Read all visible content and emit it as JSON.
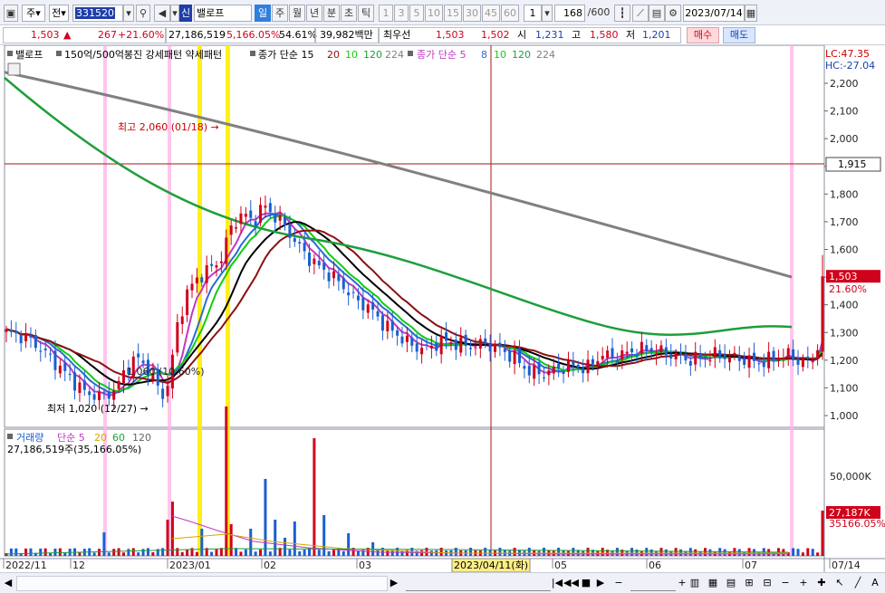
{
  "toolbar": {
    "market": "주",
    "period_type": "전",
    "stock_code": "331520",
    "stock_name": "밸로프",
    "tabs": [
      "일",
      "주",
      "월",
      "년",
      "분",
      "초",
      "틱"
    ],
    "active_tab": "일",
    "intervals": [
      "1",
      "3",
      "5",
      "10",
      "15",
      "30",
      "45",
      "60"
    ],
    "count_select": "1",
    "count_value": "168",
    "count_max": "/600",
    "date": "2023/07/14"
  },
  "quote": {
    "price": "1,503",
    "arrow": "▲",
    "change": "267",
    "change_pct": "+21.60%",
    "volume": "27,186,519",
    "volume_pct": "5,166.05%",
    "turnover_pct": "54.61%",
    "amount": "39,982백만",
    "ask_label": "최우선",
    "ask": "1,503",
    "bid": "1,502",
    "open_label": "시",
    "open": "1,231",
    "high_label": "고",
    "high": "1,580",
    "low_label": "저",
    "low": "1,201",
    "buy_label": "매수",
    "sell_label": "매도"
  },
  "legend": {
    "name": "밸로프",
    "pattern_text": "150억/500억봉진 강세패턴  약세패턴",
    "ma_label": "종가 단순 15",
    "ma_periods": [
      "20",
      "10",
      "120",
      "224"
    ],
    "ma2_label": "종가 단순 5",
    "ma2_periods": [
      "8",
      "10",
      "120",
      "224"
    ],
    "lc": "LC:47.35",
    "hc": "HC:-27.04"
  },
  "price_axis": {
    "ticks": [
      "2,200",
      "2,100",
      "2,000",
      "1,900",
      "1,800",
      "1,700",
      "1,600",
      "1,500",
      "1,400",
      "1,300",
      "1,200",
      "1,100",
      "1,000"
    ],
    "current_label": "1,503",
    "current_pct": "21.60%",
    "crosshair_label": "1,915"
  },
  "annotations": {
    "high": "최고 2,060 (01/18)",
    "low": "최저 1,020 (12/27)",
    "mid": "1,060 (10.60%)"
  },
  "volume_panel": {
    "legend_label": "거래량",
    "legend_ma": "단순 5",
    "legend_periods": [
      "20",
      "60",
      "120"
    ],
    "summary": "27,186,519주(35,166.05%)",
    "axis_tick": "50,000K",
    "current_label": "27,187K",
    "current_pct": "35166.05%"
  },
  "date_axis": {
    "labels": [
      "2022/11",
      "12",
      "2023/01",
      "02",
      "03",
      "05",
      "06",
      "07",
      "07/14"
    ],
    "crosshair_date": "2023/04/11(화)"
  },
  "colors": {
    "up": "#d0021b",
    "down": "#1a5fd0",
    "ma5": "#c238c2",
    "ma8": "#2b6bd6",
    "ma10": "#11cc11",
    "ma15": "#000000",
    "ma20": "#8b1111",
    "ma120": "#1e9e3a",
    "ma224": "#808080",
    "highlight_pink": "#ffb3e6",
    "highlight_yellow": "#ffee00"
  },
  "chart_data": {
    "type": "candlestick",
    "title": "밸로프",
    "x_range": [
      "2022/11",
      "2023/07/14"
    ],
    "y_range": [
      950,
      2260
    ],
    "price_scale_known": [
      {
        "date": "2022/12/27",
        "low": 1020
      },
      {
        "date": "2023/01/18",
        "high": 2060
      },
      {
        "date": "2023/07/14",
        "close": 1503
      }
    ],
    "series": [
      {
        "name": "224",
        "values": [
          2240,
          2060,
          1830,
          1500
        ]
      },
      {
        "name": "120",
        "values": [
          2220,
          1700,
          1420,
          1330,
          1340,
          1320
        ]
      }
    ]
  }
}
